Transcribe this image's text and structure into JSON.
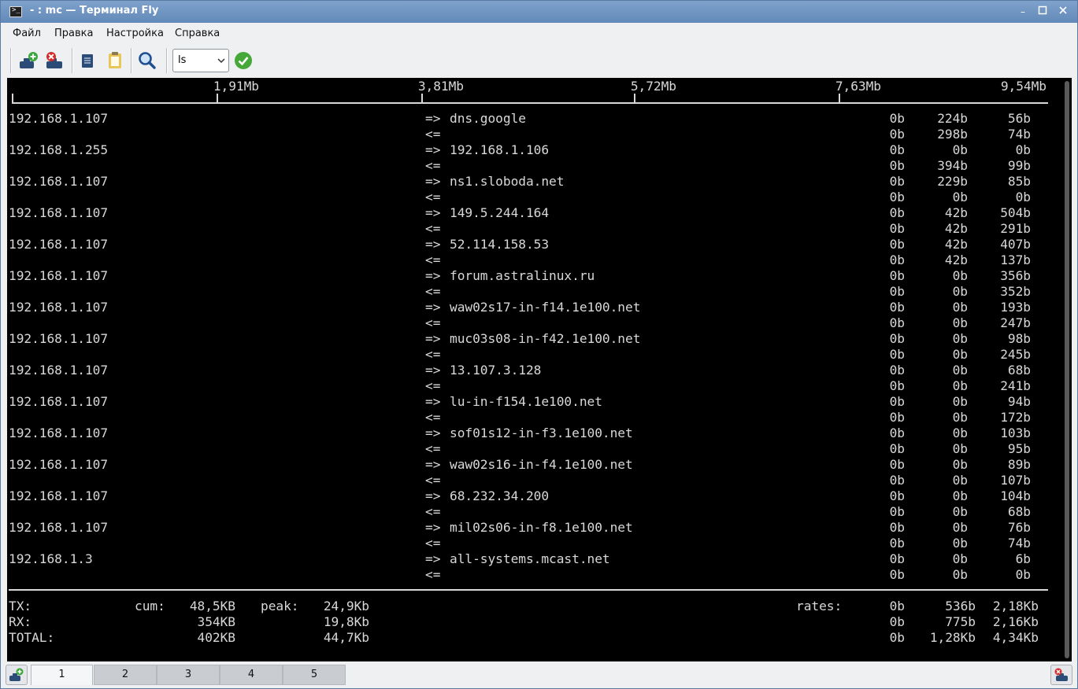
{
  "window": {
    "title": "- : mc — Терминал Fly"
  },
  "menu": [
    "Файл",
    "Правка",
    "Настройка",
    "Справка"
  ],
  "toolbar": {
    "combo_value": "ls"
  },
  "scale": [
    "1,91Mb",
    "3,81Mb",
    "5,72Mb",
    "7,63Mb",
    "9,54Mb"
  ],
  "connections": [
    {
      "src": "192.168.1.107",
      "dst": "dns.google",
      "out": [
        "0b",
        "224b",
        "56b"
      ],
      "in": [
        "0b",
        "298b",
        "74b"
      ]
    },
    {
      "src": "192.168.1.255",
      "dst": "192.168.1.106",
      "out": [
        "0b",
        "0b",
        "0b"
      ],
      "in": [
        "0b",
        "394b",
        "99b"
      ]
    },
    {
      "src": "192.168.1.107",
      "dst": "ns1.sloboda.net",
      "out": [
        "0b",
        "229b",
        "85b"
      ],
      "in": [
        "0b",
        "0b",
        "0b"
      ]
    },
    {
      "src": "192.168.1.107",
      "dst": "149.5.244.164",
      "out": [
        "0b",
        "42b",
        "504b"
      ],
      "in": [
        "0b",
        "42b",
        "291b"
      ]
    },
    {
      "src": "192.168.1.107",
      "dst": "52.114.158.53",
      "out": [
        "0b",
        "42b",
        "407b"
      ],
      "in": [
        "0b",
        "42b",
        "137b"
      ]
    },
    {
      "src": "192.168.1.107",
      "dst": "forum.astralinux.ru",
      "out": [
        "0b",
        "0b",
        "356b"
      ],
      "in": [
        "0b",
        "0b",
        "352b"
      ]
    },
    {
      "src": "192.168.1.107",
      "dst": "waw02s17-in-f14.1e100.net",
      "out": [
        "0b",
        "0b",
        "193b"
      ],
      "in": [
        "0b",
        "0b",
        "247b"
      ]
    },
    {
      "src": "192.168.1.107",
      "dst": "muc03s08-in-f42.1e100.net",
      "out": [
        "0b",
        "0b",
        "98b"
      ],
      "in": [
        "0b",
        "0b",
        "245b"
      ]
    },
    {
      "src": "192.168.1.107",
      "dst": "13.107.3.128",
      "out": [
        "0b",
        "0b",
        "68b"
      ],
      "in": [
        "0b",
        "0b",
        "241b"
      ]
    },
    {
      "src": "192.168.1.107",
      "dst": "lu-in-f154.1e100.net",
      "out": [
        "0b",
        "0b",
        "94b"
      ],
      "in": [
        "0b",
        "0b",
        "172b"
      ]
    },
    {
      "src": "192.168.1.107",
      "dst": "sof01s12-in-f3.1e100.net",
      "out": [
        "0b",
        "0b",
        "103b"
      ],
      "in": [
        "0b",
        "0b",
        "95b"
      ]
    },
    {
      "src": "192.168.1.107",
      "dst": "waw02s16-in-f4.1e100.net",
      "out": [
        "0b",
        "0b",
        "89b"
      ],
      "in": [
        "0b",
        "0b",
        "107b"
      ]
    },
    {
      "src": "192.168.1.107",
      "dst": "68.232.34.200",
      "out": [
        "0b",
        "0b",
        "104b"
      ],
      "in": [
        "0b",
        "0b",
        "68b"
      ]
    },
    {
      "src": "192.168.1.107",
      "dst": "mil02s06-in-f8.1e100.net",
      "out": [
        "0b",
        "0b",
        "76b"
      ],
      "in": [
        "0b",
        "0b",
        "74b"
      ]
    },
    {
      "src": "192.168.1.3",
      "dst": "all-systems.mcast.net",
      "out": [
        "0b",
        "0b",
        "6b"
      ],
      "in": [
        "0b",
        "0b",
        "0b"
      ]
    }
  ],
  "arrows": {
    "out": "=>",
    "in": "<="
  },
  "totals": {
    "cum_label": "cum:",
    "peak_label": "peak:",
    "rates_label": "rates:",
    "rows": [
      {
        "label": "TX:",
        "cum": "48,5KB",
        "peak": "24,9Kb",
        "rates": [
          "0b",
          "536b",
          "2,18Kb"
        ]
      },
      {
        "label": "RX:",
        "cum": "354KB",
        "peak": "19,8Kb",
        "rates": [
          "0b",
          "775b",
          "2,16Kb"
        ]
      },
      {
        "label": "TOTAL:",
        "cum": "402KB",
        "peak": "44,7Kb",
        "rates": [
          "0b",
          "1,28Kb",
          "4,34Kb"
        ]
      }
    ]
  },
  "tabs": [
    "1",
    "2",
    "3",
    "4",
    "5"
  ],
  "active_tab": 0
}
